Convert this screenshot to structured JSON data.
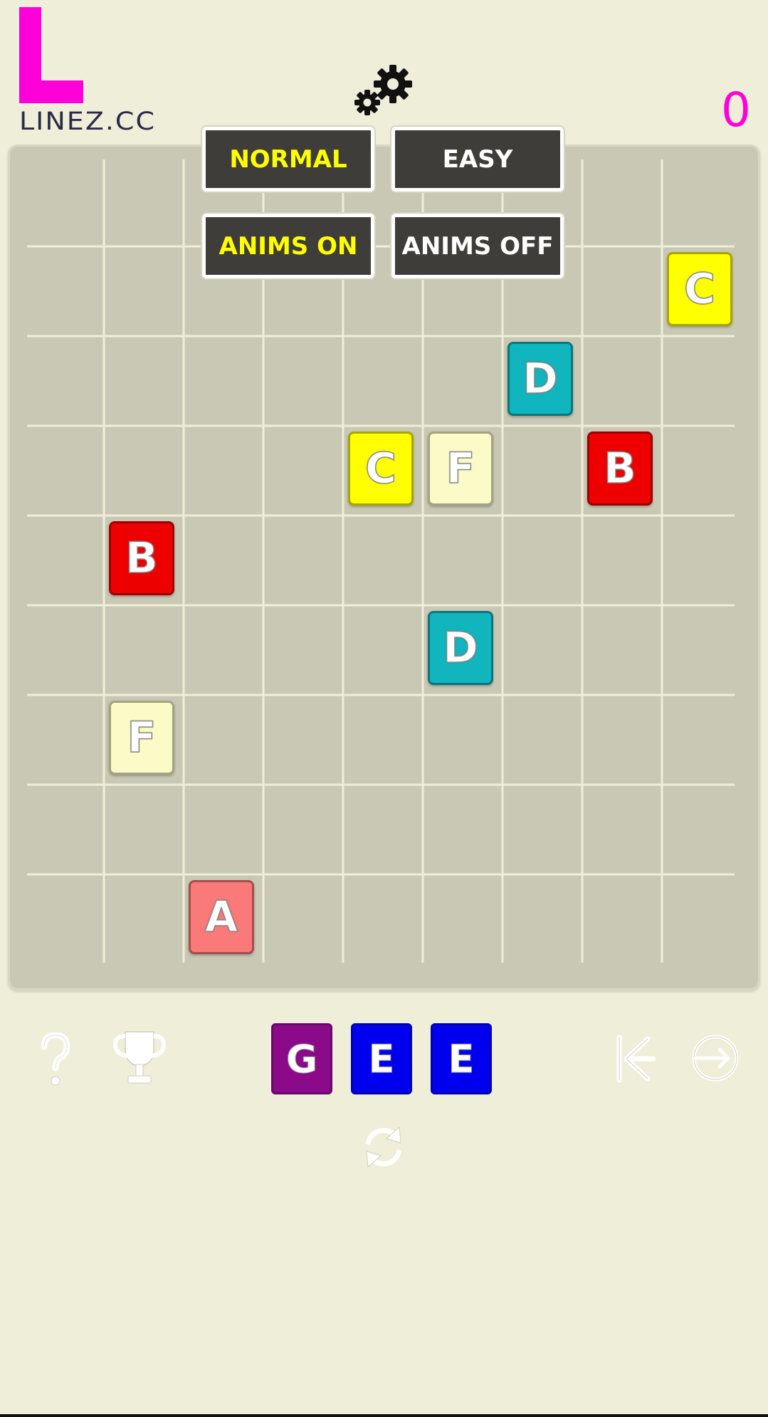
{
  "header": {
    "logo_letter": "L",
    "logo_text": "LINEZ.CC",
    "score": "0",
    "colors": {
      "logo": "#ff00d8",
      "score": "#ff00d8",
      "logo_text": "#2a2a48"
    }
  },
  "settings_menu": {
    "buttons": [
      {
        "label": "NORMAL",
        "state": "active"
      },
      {
        "label": "EASY",
        "state": "inactive"
      },
      {
        "label": "ANIMS ON",
        "state": "active"
      },
      {
        "label": "ANIMS OFF",
        "state": "inactive"
      }
    ],
    "colors": {
      "active_text": "#ffff00",
      "inactive_text": "#ffffff",
      "button_bg": "#3f3d39"
    }
  },
  "board": {
    "rows": 9,
    "cols": 9,
    "tiles": [
      {
        "letter": "C",
        "row": 1,
        "col": 8,
        "color": "#ffff00"
      },
      {
        "letter": "D",
        "row": 2,
        "col": 6,
        "color": "#11b5bd"
      },
      {
        "letter": "C",
        "row": 3,
        "col": 4,
        "color": "#ffff00"
      },
      {
        "letter": "F",
        "row": 3,
        "col": 5,
        "color": "#fbfbc7"
      },
      {
        "letter": "B",
        "row": 3,
        "col": 7,
        "color": "#ee0000"
      },
      {
        "letter": "B",
        "row": 4,
        "col": 1,
        "color": "#ee0000"
      },
      {
        "letter": "D",
        "row": 5,
        "col": 5,
        "color": "#11b5bd"
      },
      {
        "letter": "F",
        "row": 6,
        "col": 1,
        "color": "#fbfbc7"
      },
      {
        "letter": "A",
        "row": 8,
        "col": 2,
        "color": "#fa7a7a"
      }
    ],
    "colors": {
      "board_bg": "#c9c8b4",
      "grid_line": "#efeed9"
    }
  },
  "next_tiles": [
    {
      "letter": "G",
      "color": "#8a0a8a"
    },
    {
      "letter": "E",
      "color": "#0000ee"
    },
    {
      "letter": "E",
      "color": "#0000ee"
    }
  ],
  "bottom_icons": {
    "help": "question-mark-icon",
    "trophy": "trophy-icon",
    "refresh": "refresh-icon",
    "share": "share-icon",
    "exit": "exit-icon"
  }
}
